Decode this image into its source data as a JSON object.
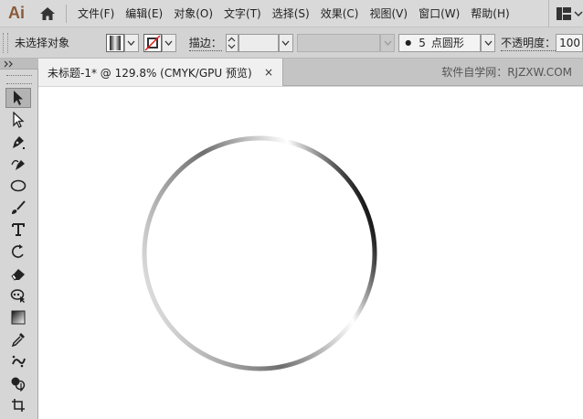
{
  "app": {
    "logo_text": "Ai"
  },
  "menu": {
    "items": [
      "文件(F)",
      "编辑(E)",
      "对象(O)",
      "文字(T)",
      "选择(S)",
      "效果(C)",
      "视图(V)",
      "窗口(W)",
      "帮助(H)"
    ]
  },
  "control": {
    "selection_status": "未选择对象",
    "stroke_label": "描边：",
    "brush_size": "5",
    "brush_name": "点圆形",
    "opacity_label": "不透明度：",
    "opacity_value": "100"
  },
  "document": {
    "tab_title": "未标题-1* @ 129.8% (CMYK/GPU 预览)",
    "close_glyph": "×",
    "watermark": "软件自学网：RJZXW.COM"
  },
  "tools": [
    {
      "name": "selection-tool",
      "active": true
    },
    {
      "name": "direct-selection-tool",
      "active": false
    },
    {
      "name": "pen-tool",
      "active": false
    },
    {
      "name": "curvature-tool",
      "active": false
    },
    {
      "name": "ellipse-tool",
      "active": false
    },
    {
      "name": "paintbrush-tool",
      "active": false
    },
    {
      "name": "type-tool",
      "active": false
    },
    {
      "name": "rotate-tool",
      "active": false
    },
    {
      "name": "eraser-tool",
      "active": false
    },
    {
      "name": "puppet-warp-tool",
      "active": false
    },
    {
      "name": "gradient-tool",
      "active": false
    },
    {
      "name": "eyedropper-tool",
      "active": false
    },
    {
      "name": "symbol-sprayer-tool",
      "active": false
    },
    {
      "name": "shape-builder-tool",
      "active": false
    },
    {
      "name": "artboard-tool",
      "active": false
    }
  ],
  "artwork": {
    "shape": "circle",
    "stroke": "gradient",
    "stroke_colors": [
      "#d9d9d9",
      "#6e6e6e",
      "#1a1a1a",
      "#ffffff"
    ]
  },
  "colors": {
    "logo": "#8a5a3a",
    "ui_background": "#d6d6d6",
    "canvas": "#ffffff"
  }
}
